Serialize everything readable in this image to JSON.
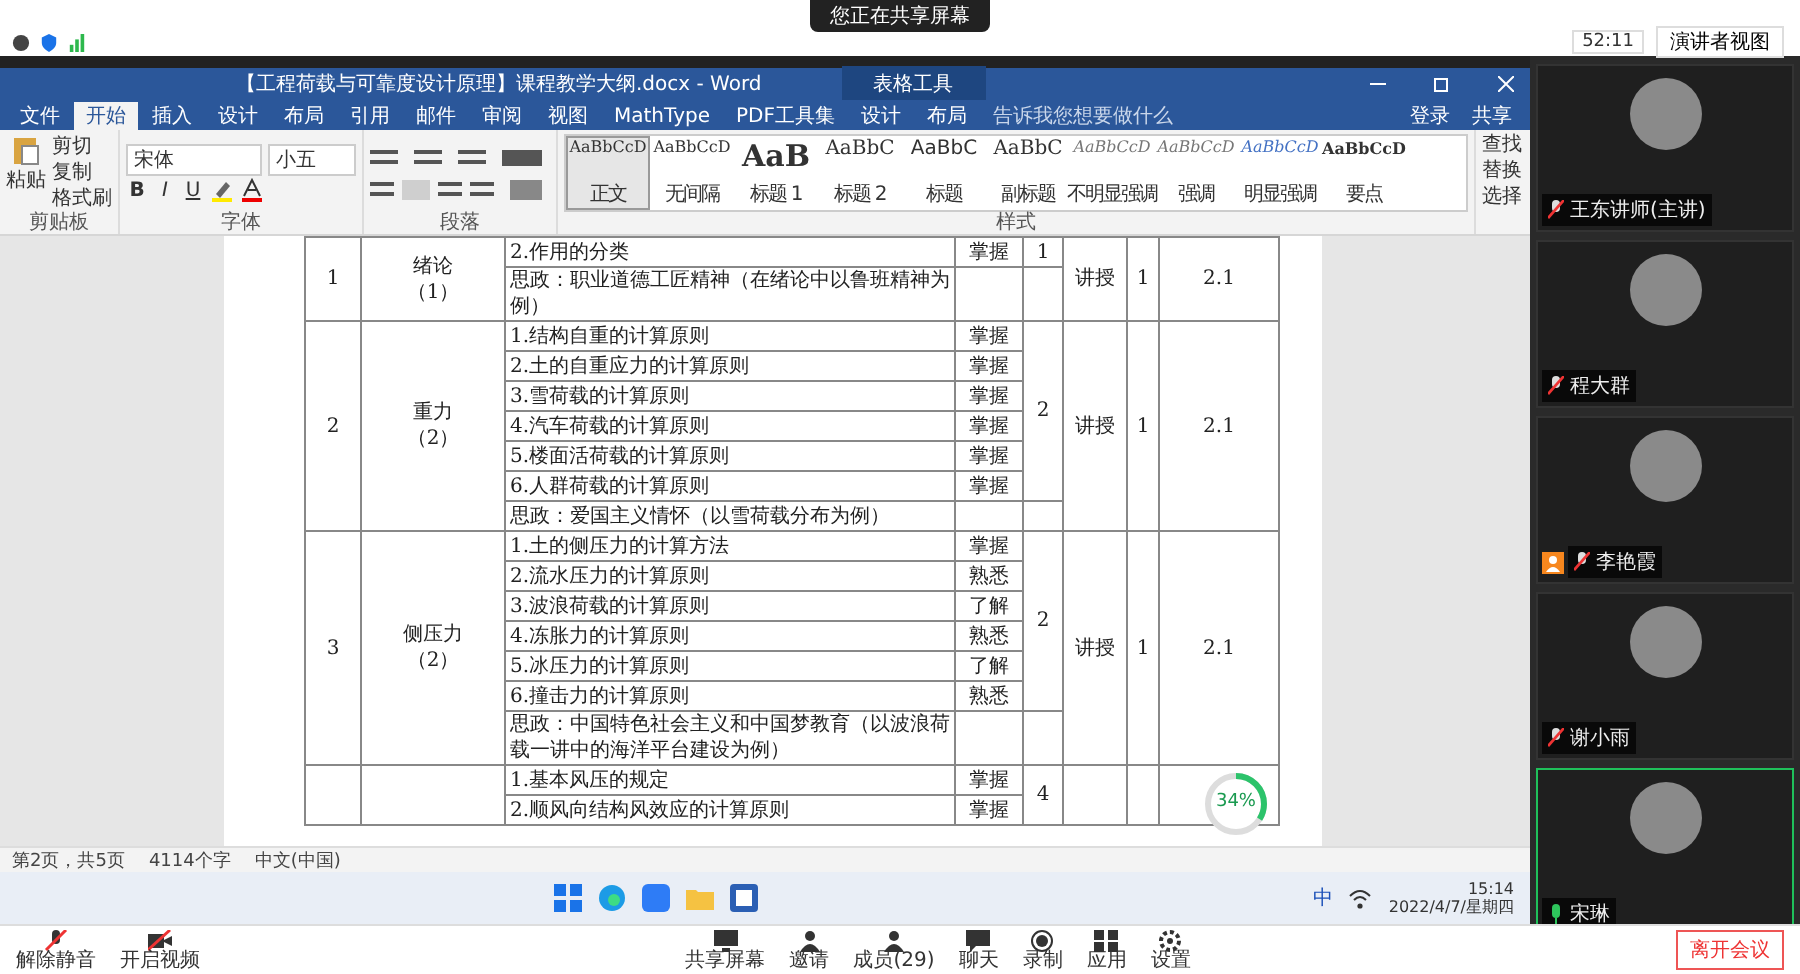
{
  "share_bar": {
    "notice": "您正在共享屏幕",
    "timer": "52:11",
    "view_button": "演讲者视图"
  },
  "word": {
    "title": "【工程荷载与可靠度设计原理】课程教学大纲.docx - Word",
    "context_tab": "表格工具",
    "tabs": [
      {
        "label": "文件",
        "selected": false
      },
      {
        "label": "开始",
        "selected": true
      },
      {
        "label": "插入",
        "selected": false
      },
      {
        "label": "设计",
        "selected": false
      },
      {
        "label": "布局",
        "selected": false
      },
      {
        "label": "引用",
        "selected": false
      },
      {
        "label": "邮件",
        "selected": false
      },
      {
        "label": "审阅",
        "selected": false
      },
      {
        "label": "视图",
        "selected": false
      },
      {
        "label": "MathType",
        "selected": false
      },
      {
        "label": "PDF工具集",
        "selected": false
      },
      {
        "label": "设计",
        "selected": false
      },
      {
        "label": "布局",
        "selected": false
      }
    ],
    "search_placeholder": "告诉我您想要做什么",
    "sign_in": "登录",
    "share": "共享",
    "ribbon": {
      "clipboard": {
        "paste": "粘贴",
        "cut": "剪切",
        "copy": "复制",
        "format_painter": "格式刷",
        "label": "剪贴板"
      },
      "font": {
        "name": "宋体",
        "size": "小五",
        "format_buttons": [
          "B",
          "I",
          "U"
        ],
        "label": "字体"
      },
      "paragraph": {
        "label": "段落"
      },
      "styles": {
        "label": "样式",
        "items": [
          {
            "preview": "AaBbCcD",
            "name": "正文",
            "kind": "normal",
            "selected": true
          },
          {
            "preview": "AaBbCcD",
            "name": "无间隔",
            "kind": "normal",
            "selected": false
          },
          {
            "preview": "AaB",
            "name": "标题 1",
            "kind": "heading",
            "selected": false
          },
          {
            "preview": "AaBbC",
            "name": "标题 2",
            "kind": "heading2",
            "selected": false
          },
          {
            "preview": "AaBbC",
            "name": "标题",
            "kind": "title",
            "selected": false
          },
          {
            "preview": "AaBbC",
            "name": "副标题",
            "kind": "heading2",
            "selected": false
          },
          {
            "preview": "AaBbCcD",
            "name": "不明显强调",
            "kind": "subtle",
            "selected": false
          },
          {
            "preview": "AaBbCcD",
            "name": "强调",
            "kind": "subtle",
            "selected": false
          },
          {
            "preview": "AaBbCcD",
            "name": "明显强调",
            "kind": "accent",
            "selected": false
          },
          {
            "preview": "AaBbCcD",
            "name": "要点",
            "kind": "strong",
            "selected": false
          }
        ]
      },
      "editing": [
        "查找",
        "替换",
        "选择"
      ]
    }
  },
  "table": {
    "chapters": [
      {
        "number": "1",
        "title": "绪论",
        "title_note": "（1）",
        "hours": "1",
        "method": "讲授",
        "count": "1",
        "objective": "2.1",
        "topics": [
          {
            "kind": "item",
            "text": "2.作用的分类",
            "requirement": "掌握"
          },
          {
            "kind": "ideology",
            "text": "思政：职业道德工匠精神（在绪论中以鲁班精神为例）"
          }
        ]
      },
      {
        "number": "2",
        "title": "重力",
        "title_note": "（2）",
        "hours": "2",
        "method": "讲授",
        "count": "1",
        "objective": "2.1",
        "topics": [
          {
            "kind": "item",
            "text": "1.结构自重的计算原则",
            "requirement": "掌握"
          },
          {
            "kind": "item",
            "text": "2.土的自重应力的计算原则",
            "requirement": "掌握"
          },
          {
            "kind": "item",
            "text": "3.雪荷载的计算原则",
            "requirement": "掌握"
          },
          {
            "kind": "item",
            "text": "4.汽车荷载的计算原则",
            "requirement": "掌握"
          },
          {
            "kind": "item",
            "text": "5.楼面活荷载的计算原则",
            "requirement": "掌握"
          },
          {
            "kind": "item",
            "text": "6.人群荷载的计算原则",
            "requirement": "掌握"
          },
          {
            "kind": "ideology",
            "text": "思政：爱国主义情怀（以雪荷载分布为例）"
          }
        ]
      },
      {
        "number": "3",
        "title": "侧压力",
        "title_note": "（2）",
        "hours": "2",
        "method": "讲授",
        "count": "1",
        "objective": "2.1",
        "topics": [
          {
            "kind": "item",
            "text": "1.土的侧压力的计算方法",
            "requirement": "掌握"
          },
          {
            "kind": "item",
            "text": "2.流水压力的计算原则",
            "requirement": "熟悉"
          },
          {
            "kind": "item",
            "text": "3.波浪荷载的计算原则",
            "requirement": "了解"
          },
          {
            "kind": "item",
            "text": "4.冻胀力的计算原则",
            "requirement": "熟悉"
          },
          {
            "kind": "item",
            "text": "5.冰压力的计算原则",
            "requirement": "了解"
          },
          {
            "kind": "item",
            "text": "6.撞击力的计算原则",
            "requirement": "熟悉"
          },
          {
            "kind": "ideology",
            "text": "思政：中国特色社会主义和中国梦教育（以波浪荷载一讲中的海洋平台建设为例）"
          }
        ]
      },
      {
        "hours": "4",
        "topics": [
          {
            "kind": "item",
            "text": "1.基本风压的规定",
            "requirement": "掌握"
          },
          {
            "kind": "item",
            "text": "2.顺风向结构风效应的计算原则",
            "requirement": "掌握"
          }
        ]
      }
    ]
  },
  "progress": {
    "level": 0.34,
    "label": "34%"
  },
  "status_bar": {
    "page": "第2页，共5页",
    "words": "4114个字",
    "language": "中文(中国)"
  },
  "taskbar": {
    "ime": "中",
    "time": "15:14",
    "date": "2022/4/7/星期四"
  },
  "participants": [
    {
      "name": "王东讲师(主讲)",
      "muted": true,
      "speaking": false,
      "host": false
    },
    {
      "name": "程大群",
      "muted": true,
      "speaking": false,
      "host": false
    },
    {
      "name": "李艳霞",
      "muted": true,
      "speaking": false,
      "host": true
    },
    {
      "name": "谢小雨",
      "muted": true,
      "speaking": false,
      "host": false
    },
    {
      "name": "宋琳",
      "muted": false,
      "speaking": true,
      "host": false
    }
  ],
  "meeting_toolbar": {
    "left": [
      {
        "kind": "mic-off",
        "label": "解除静音"
      },
      {
        "kind": "video-off",
        "label": "开启视频"
      }
    ],
    "center": [
      {
        "kind": "share",
        "label": "共享屏幕"
      },
      {
        "kind": "invite",
        "label": "邀请"
      },
      {
        "kind": "members",
        "label": "成员(29)"
      },
      {
        "kind": "chat",
        "label": "聊天"
      },
      {
        "kind": "record",
        "label": "录制"
      },
      {
        "kind": "apps",
        "label": "应用"
      },
      {
        "kind": "settings",
        "label": "设置"
      }
    ],
    "leave": "离开会议"
  }
}
